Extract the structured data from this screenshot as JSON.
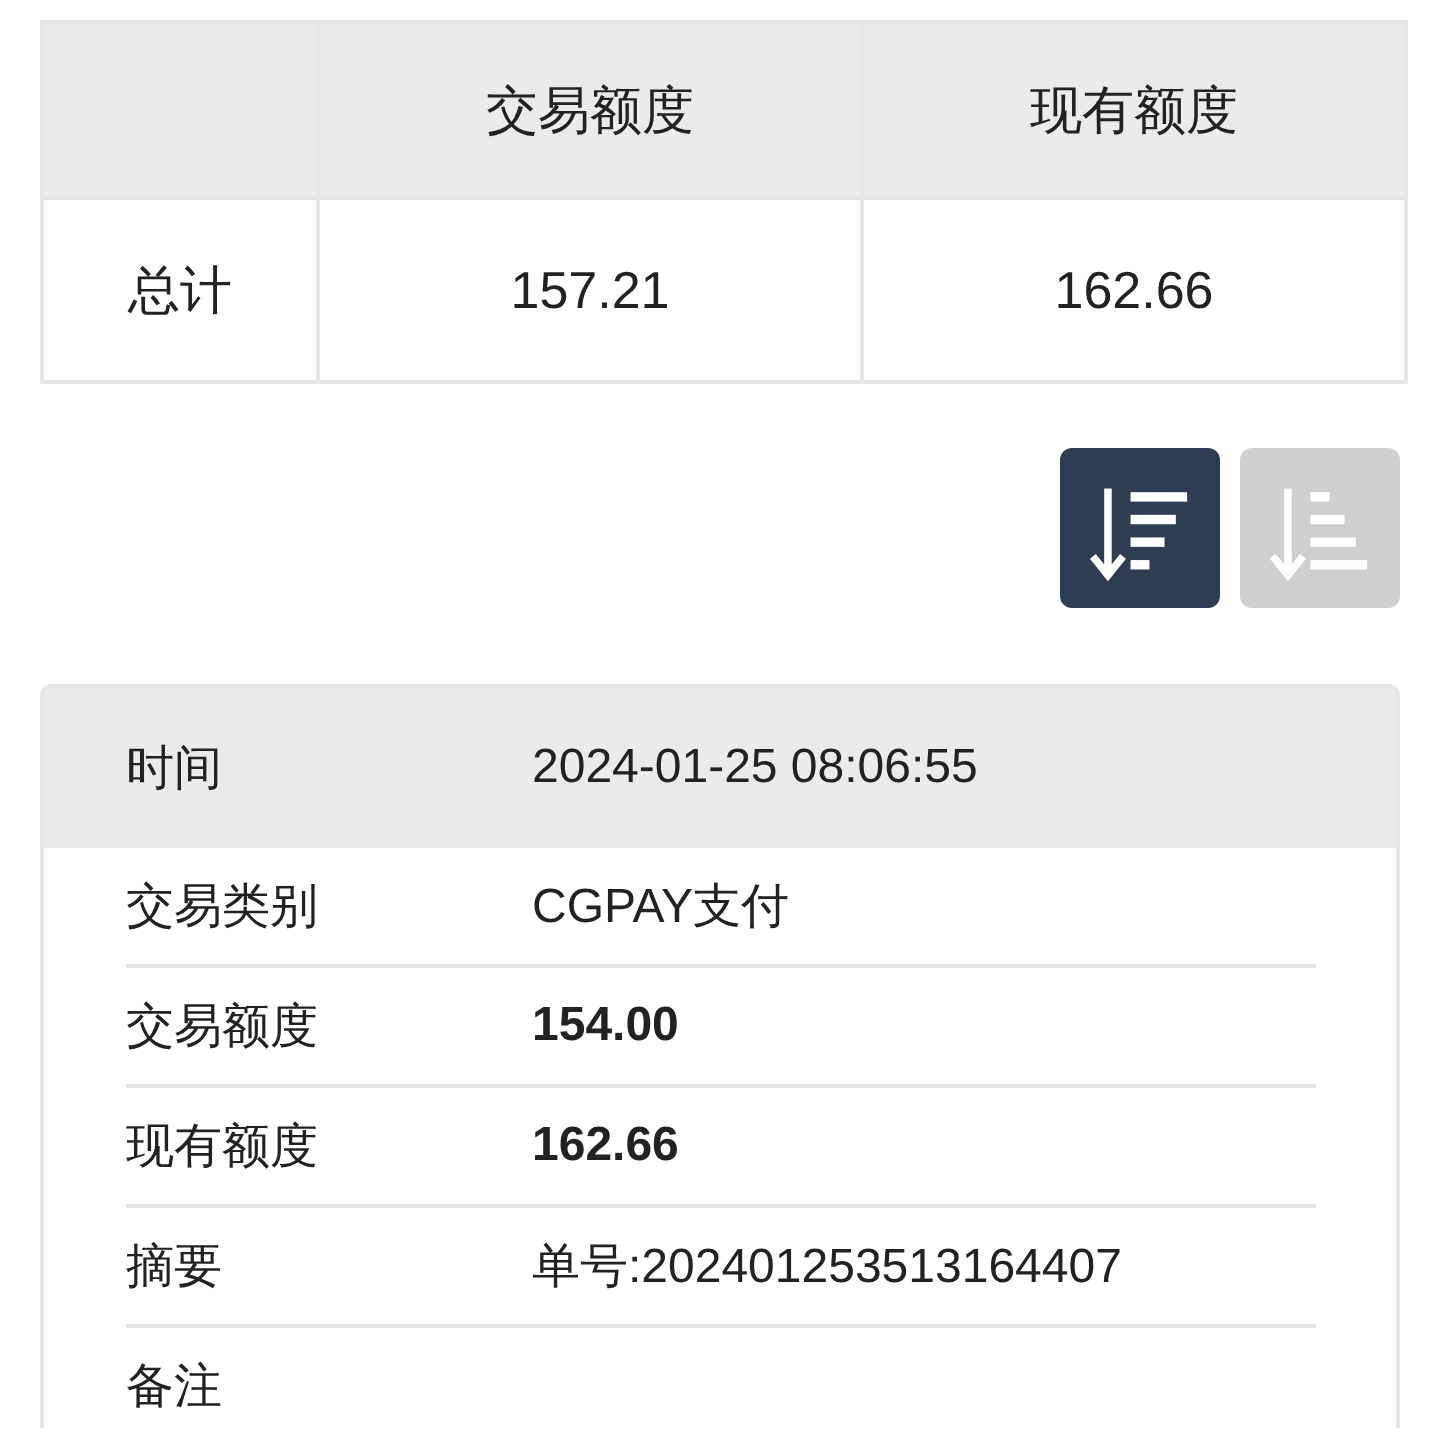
{
  "summary": {
    "columns": [
      "交易额度",
      "现有额度"
    ],
    "rows": [
      {
        "label": "总计",
        "cells": [
          "157.21",
          "162.66"
        ]
      }
    ]
  },
  "sort_buttons": [
    {
      "kind": "descending",
      "selected": true
    },
    {
      "kind": "ascending",
      "selected": false
    }
  ],
  "record": {
    "header": {
      "label": "时间",
      "value": "2024-01-25 08:06:55"
    },
    "fields": [
      {
        "label": "交易类别",
        "value": "CGPAY支付"
      },
      {
        "label": "交易额度",
        "value": "154.00",
        "bold": true
      },
      {
        "label": "现有额度",
        "value": "162.66",
        "bold": true
      },
      {
        "label": "摘要",
        "value": "单号:202401253513164407"
      },
      {
        "label": "备注"
      }
    ]
  }
}
